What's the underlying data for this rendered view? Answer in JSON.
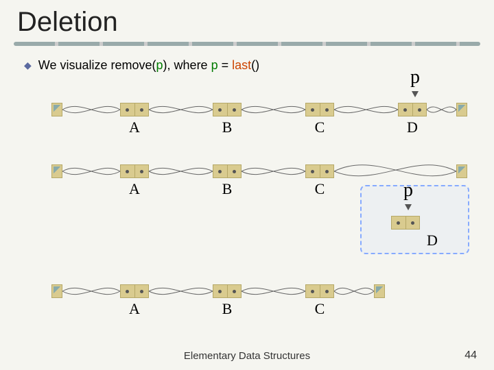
{
  "title": "Deletion",
  "bullet_prefix": "We visualize ",
  "bullet_remove": "remove",
  "bullet_paren_open": "(",
  "bullet_p1": "p",
  "bullet_mid": "), where ",
  "bullet_p2": "p",
  "bullet_eq": " = ",
  "bullet_last": "last",
  "bullet_paren2": "()",
  "p_label_top": "p",
  "p_label_mid": "p",
  "row1": {
    "a": "A",
    "b": "B",
    "c": "C",
    "d": "D"
  },
  "row2": {
    "a": "A",
    "b": "B",
    "c": "C"
  },
  "row2d": "D",
  "row3": {
    "a": "A",
    "b": "B",
    "c": "C"
  },
  "footer": "Elementary Data Structures",
  "slidenum": "44"
}
